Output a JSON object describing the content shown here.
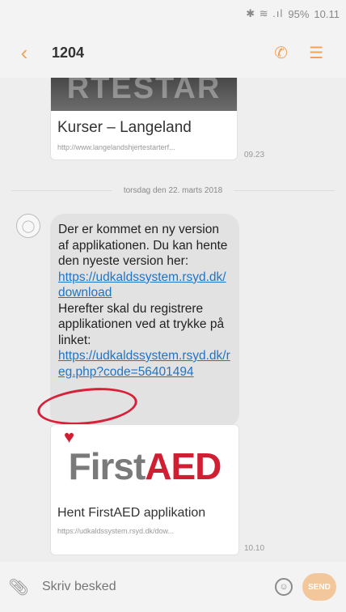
{
  "status_bar": {
    "icons": "✱ ≋ .ıl",
    "battery": "95%",
    "time": "10.11"
  },
  "header": {
    "title": "1204",
    "back_icon": "chevron-left-icon",
    "call_icon": "phone-icon",
    "menu_icon": "menu-icon"
  },
  "conversation": {
    "card1": {
      "banner_text": "RTESTAR",
      "title": "Kurser – Langeland",
      "url": "http://www.langelandshjertestarterf...",
      "time": "09.23"
    },
    "date_separator": "torsdag den 22. marts 2018",
    "message": {
      "text_1": "Der er kommet en ny version af applikationen. Du kan hente den nyeste version her:",
      "link_1": "https://udkaldssystem.rsyd.dk/download",
      "text_2": "Herefter skal du registrere applikationen ved at trykke på linket:",
      "link_2": "https://udkaldssystem.rsyd.dk/reg.php?code=56401494"
    },
    "card2": {
      "logo_first": "First",
      "logo_aed": "AED",
      "title": "Hent FirstAED applikation",
      "url": "https://udkaldssystem.rsyd.dk/dow...",
      "time": "10.10"
    }
  },
  "composer": {
    "placeholder": "Skriv besked",
    "send_label": "SEND"
  },
  "colors": {
    "accent": "#f0a35a",
    "link": "#1f74c8",
    "annotation": "#d8203a"
  }
}
